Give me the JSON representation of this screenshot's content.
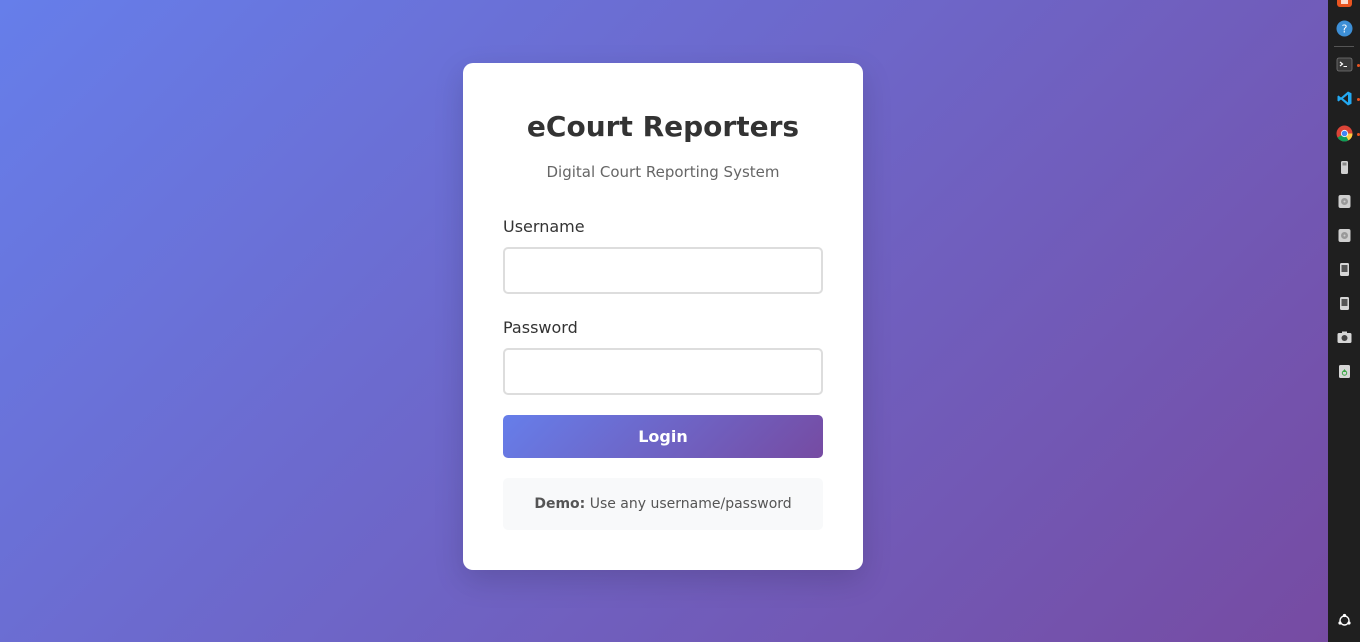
{
  "login": {
    "title": "eCourt Reporters",
    "subtitle": "Digital Court Reporting System",
    "username_label": "Username",
    "username_value": "",
    "password_label": "Password",
    "password_value": "",
    "login_button": "Login",
    "demo_label": "Demo:",
    "demo_text": " Use any username/password"
  },
  "colors": {
    "gradient_start": "#667eea",
    "gradient_end": "#764ba2",
    "card": "#ffffff",
    "demo_bg": "#f8f9fa",
    "dock_bg": "#1f1f1f"
  },
  "dock": {
    "items": [
      "app-store-icon",
      "help-icon",
      "terminal-icon",
      "vscode-icon",
      "chrome-icon",
      "usb-drive-icon",
      "disk-icon",
      "disk-icon",
      "removable-drive-icon",
      "removable-drive-icon",
      "screenshot-icon",
      "trash-icon",
      "show-apps-icon"
    ]
  }
}
